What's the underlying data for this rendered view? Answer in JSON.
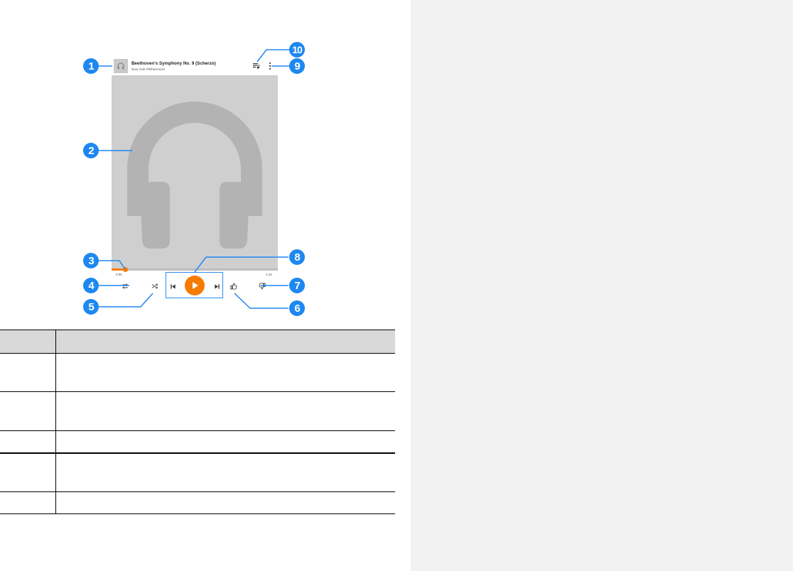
{
  "player": {
    "song_title": "Beethoven's Symphony No. 9 (Scherzo)",
    "artist": "New York Philharmonic",
    "elapsed": "0:06",
    "duration": "1:16",
    "progress_fraction": 0.08
  },
  "icons": {
    "thumbnail": "headphones-icon",
    "album_art": "headphones-icon",
    "queue": "queue-icon",
    "menu": "more-vert-icon",
    "repeat": "repeat-icon",
    "shuffle": "shuffle-icon",
    "previous": "skip-previous-icon",
    "play": "play-icon",
    "next": "skip-next-icon",
    "thumbs_up": "thumbs-up-icon",
    "thumbs_down": "thumbs-down-icon"
  },
  "callouts": [
    "1",
    "2",
    "3",
    "4",
    "5",
    "6",
    "7",
    "8",
    "9",
    "10"
  ],
  "colors": {
    "accent": "#f57c00",
    "callout": "#1e88f0",
    "side_panel": "#f2f2f2"
  },
  "table": {
    "header": [
      "",
      ""
    ],
    "rows": [
      [
        "",
        ""
      ],
      [
        "",
        ""
      ],
      [
        "",
        ""
      ],
      [
        "",
        ""
      ],
      [
        "",
        ""
      ]
    ]
  }
}
